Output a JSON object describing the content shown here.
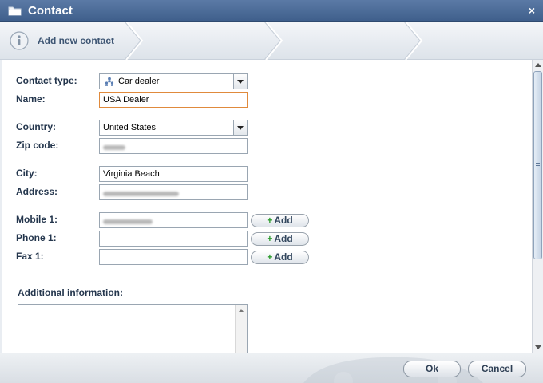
{
  "window": {
    "title": "Contact",
    "close_glyph": "×"
  },
  "wizard": {
    "step1_label": "Add new contact"
  },
  "form": {
    "contact_type": {
      "label": "Contact type:",
      "value": "Car dealer"
    },
    "name": {
      "label": "Name:",
      "value": "USA Dealer"
    },
    "country": {
      "label": "Country:",
      "value": "United States"
    },
    "zip": {
      "label": "Zip code:",
      "value": ""
    },
    "city": {
      "label": "City:",
      "value": "Virginia Beach"
    },
    "address": {
      "label": "Address:",
      "value": ""
    },
    "mobile1": {
      "label": "Mobile 1:",
      "value": ""
    },
    "phone1": {
      "label": "Phone 1:",
      "value": ""
    },
    "fax1": {
      "label": "Fax 1:",
      "value": ""
    },
    "add_label": "Add",
    "add_plus": "+",
    "additional_info": {
      "label": "Additional information:",
      "value": ""
    }
  },
  "footer": {
    "ok_label": "Ok",
    "cancel_label": "Cancel"
  },
  "colors": {
    "title_bar": "#4a6a97",
    "active_border": "#e08a3c",
    "add_plus": "#2c9b2c"
  },
  "icons": {
    "title": "folder-icon",
    "step": "info-icon",
    "contact_type": "people-icon",
    "close": "close-icon"
  }
}
